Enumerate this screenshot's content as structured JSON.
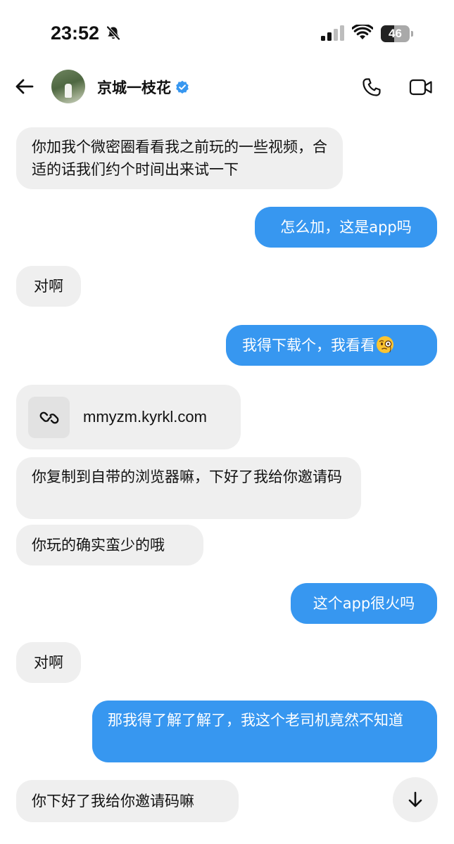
{
  "status_bar": {
    "time": "23:52",
    "battery_level": "46",
    "battery_fraction": 0.46,
    "icons": [
      "bell-slash-icon",
      "cellular-signal-icon",
      "wifi-icon",
      "battery-icon"
    ]
  },
  "header": {
    "back_icon": "arrow-left-icon",
    "contact_name": "京城一枝花",
    "verified_icon": "verified-badge-icon",
    "call_icon": "phone-icon",
    "video_icon": "video-camera-icon"
  },
  "colors": {
    "outgoing_bubble": "#3797f0",
    "incoming_bubble": "#efefef",
    "verified": "#3797f0"
  },
  "messages": [
    {
      "direction": "incoming",
      "text": "你加我个微密圈看看我之前玩的一些视频，合适的话我们约个时间出来试一下"
    },
    {
      "direction": "outgoing",
      "text": "怎么加，这是app吗"
    },
    {
      "direction": "incoming",
      "text": "对啊"
    },
    {
      "direction": "outgoing",
      "text": "我得下载个，我看看",
      "emoji": "face-with-monocle"
    },
    {
      "direction": "incoming",
      "type": "link",
      "icon": "link-icon",
      "text": "mmyzm.kyrkl.com"
    },
    {
      "direction": "incoming",
      "text": "你复制到自带的浏览器嘛，下好了我给你邀请码"
    },
    {
      "direction": "incoming",
      "text": "你玩的确实蛮少的哦"
    },
    {
      "direction": "outgoing",
      "text": "这个app很火吗"
    },
    {
      "direction": "incoming",
      "text": "对啊"
    },
    {
      "direction": "outgoing",
      "text": "那我得了解了解了，我这个老司机竟然不知道"
    },
    {
      "direction": "incoming",
      "text": "你下好了我给你邀请码嘛"
    }
  ],
  "scroll_button_icon": "arrow-down-icon"
}
